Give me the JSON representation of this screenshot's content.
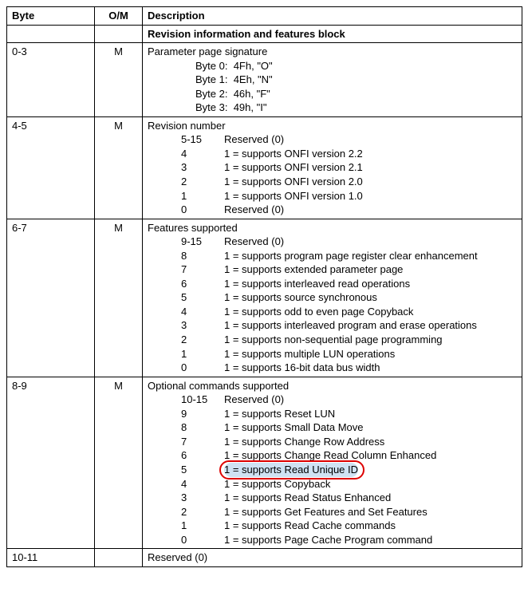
{
  "headers": {
    "byte": "Byte",
    "om": "O/M",
    "desc": "Description"
  },
  "section_title": "Revision information and features block",
  "rows": [
    {
      "byte": "0-3",
      "om": "M",
      "title": "Parameter page signature",
      "sig": [
        "Byte 0:  4Fh, \"O\"",
        "Byte 1:  4Eh, \"N\"",
        "Byte 2:  46h, \"F\"",
        "Byte 3:  49h, \"I\""
      ]
    },
    {
      "byte": "4-5",
      "om": "M",
      "title": "Revision number",
      "bits": [
        {
          "k": "5-15",
          "v": "Reserved (0)"
        },
        {
          "k": "4",
          "v": "1 = supports ONFI version 2.2"
        },
        {
          "k": "3",
          "v": "1 = supports ONFI version 2.1"
        },
        {
          "k": "2",
          "v": "1 = supports ONFI version 2.0"
        },
        {
          "k": "1",
          "v": "1 = supports ONFI version 1.0"
        },
        {
          "k": "0",
          "v": "Reserved (0)"
        }
      ]
    },
    {
      "byte": "6-7",
      "om": "M",
      "title": "Features supported",
      "bits": [
        {
          "k": "9-15",
          "v": "Reserved (0)"
        },
        {
          "k": "8",
          "v": "1 = supports program page register clear enhancement"
        },
        {
          "k": "7",
          "v": "1 = supports extended parameter page"
        },
        {
          "k": "6",
          "v": "1 = supports interleaved read operations"
        },
        {
          "k": "5",
          "v": "1 = supports source synchronous"
        },
        {
          "k": "4",
          "v": "1 = supports odd to even page Copyback"
        },
        {
          "k": "3",
          "v": "1 = supports interleaved program and erase operations"
        },
        {
          "k": "2",
          "v": "1 = supports non-sequential page programming"
        },
        {
          "k": "1",
          "v": "1 = supports multiple LUN operations"
        },
        {
          "k": "0",
          "v": "1 = supports 16-bit data bus width"
        }
      ]
    },
    {
      "byte": "8-9",
      "om": "M",
      "title": "Optional commands supported",
      "bits": [
        {
          "k": "10-15",
          "v": "Reserved (0)"
        },
        {
          "k": "9",
          "v": "1 = supports Reset LUN"
        },
        {
          "k": "8",
          "v": "1 = supports Small Data Move"
        },
        {
          "k": "7",
          "v": "1 = supports Change Row Address"
        },
        {
          "k": "6",
          "v": "1 = supports Change Read Column Enhanced"
        },
        {
          "k": "5",
          "v": "1 = supports Read Unique ID",
          "highlight": true
        },
        {
          "k": "4",
          "v": "1 = supports Copyback"
        },
        {
          "k": "3",
          "v": "1 = supports Read Status Enhanced"
        },
        {
          "k": "2",
          "v": "1 = supports Get Features and Set Features"
        },
        {
          "k": "1",
          "v": "1 = supports Read Cache commands"
        },
        {
          "k": "0",
          "v": "1 = supports Page Cache Program command"
        }
      ]
    },
    {
      "byte": "10-11",
      "om": "",
      "title": "Reserved (0)"
    }
  ]
}
